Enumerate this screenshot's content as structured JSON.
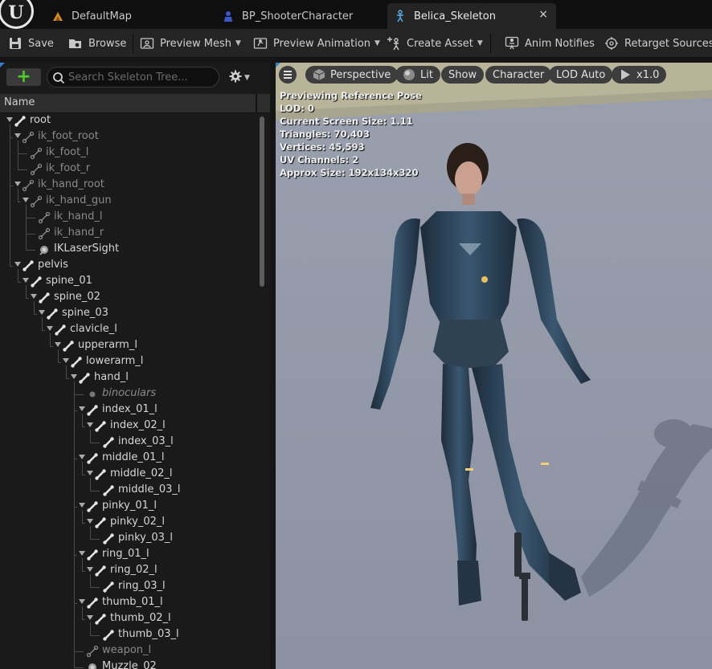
{
  "tabs": [
    {
      "label": "DefaultMap"
    },
    {
      "label": "BP_ShooterCharacter"
    },
    {
      "label": "Belica_Skeleton",
      "close": "×"
    }
  ],
  "toolbar": {
    "save": "Save",
    "browse": "Browse",
    "preview_mesh": "Preview Mesh",
    "preview_animation": "Preview Animation",
    "create_asset": "Create Asset",
    "anim_notifies": "Anim Notifies",
    "retarget_sources": "Retarget Sources"
  },
  "skeleton_tree": {
    "add_label": "+",
    "search_placeholder": "Search Skeleton Tree...",
    "column_name": "Name",
    "bones": [
      {
        "label": "root",
        "depth": 0,
        "kind": "bone",
        "expanded": true
      },
      {
        "label": "ik_foot_root",
        "depth": 1,
        "kind": "ik",
        "expanded": true
      },
      {
        "label": "ik_foot_l",
        "depth": 2,
        "kind": "ik"
      },
      {
        "label": "ik_foot_r",
        "depth": 2,
        "kind": "ik"
      },
      {
        "label": "ik_hand_root",
        "depth": 1,
        "kind": "ik",
        "expanded": true
      },
      {
        "label": "ik_hand_gun",
        "depth": 2,
        "kind": "ik",
        "expanded": true
      },
      {
        "label": "ik_hand_l",
        "depth": 3,
        "kind": "ik"
      },
      {
        "label": "ik_hand_r",
        "depth": 3,
        "kind": "ik"
      },
      {
        "label": "IKLaserSight",
        "depth": 3,
        "kind": "mesh-socket"
      },
      {
        "label": "pelvis",
        "depth": 1,
        "kind": "bone",
        "expanded": true
      },
      {
        "label": "spine_01",
        "depth": 2,
        "kind": "bone",
        "expanded": true
      },
      {
        "label": "spine_02",
        "depth": 3,
        "kind": "bone",
        "expanded": true
      },
      {
        "label": "spine_03",
        "depth": 4,
        "kind": "bone",
        "expanded": true
      },
      {
        "label": "clavicle_l",
        "depth": 5,
        "kind": "bone",
        "expanded": true
      },
      {
        "label": "upperarm_l",
        "depth": 6,
        "kind": "bone",
        "expanded": true
      },
      {
        "label": "lowerarm_l",
        "depth": 7,
        "kind": "bone",
        "expanded": true
      },
      {
        "label": "hand_l",
        "depth": 8,
        "kind": "bone",
        "expanded": true
      },
      {
        "label": "binoculars",
        "depth": 9,
        "kind": "socket"
      },
      {
        "label": "index_01_l",
        "depth": 9,
        "kind": "bone",
        "expanded": true
      },
      {
        "label": "index_02_l",
        "depth": 10,
        "kind": "bone",
        "expanded": true
      },
      {
        "label": "index_03_l",
        "depth": 11,
        "kind": "bone"
      },
      {
        "label": "middle_01_l",
        "depth": 9,
        "kind": "bone",
        "expanded": true
      },
      {
        "label": "middle_02_l",
        "depth": 10,
        "kind": "bone",
        "expanded": true
      },
      {
        "label": "middle_03_l",
        "depth": 11,
        "kind": "bone"
      },
      {
        "label": "pinky_01_l",
        "depth": 9,
        "kind": "bone",
        "expanded": true
      },
      {
        "label": "pinky_02_l",
        "depth": 10,
        "kind": "bone",
        "expanded": true
      },
      {
        "label": "pinky_03_l",
        "depth": 11,
        "kind": "bone"
      },
      {
        "label": "ring_01_l",
        "depth": 9,
        "kind": "bone",
        "expanded": true
      },
      {
        "label": "ring_02_l",
        "depth": 10,
        "kind": "bone",
        "expanded": true
      },
      {
        "label": "ring_03_l",
        "depth": 11,
        "kind": "bone"
      },
      {
        "label": "thumb_01_l",
        "depth": 9,
        "kind": "bone",
        "expanded": true
      },
      {
        "label": "thumb_02_l",
        "depth": 10,
        "kind": "bone",
        "expanded": true
      },
      {
        "label": "thumb_03_l",
        "depth": 11,
        "kind": "bone"
      },
      {
        "label": "weapon_l",
        "depth": 9,
        "kind": "ik"
      },
      {
        "label": "Muzzle_02",
        "depth": 9,
        "kind": "mesh-socket"
      }
    ]
  },
  "viewport": {
    "perspective": "Perspective",
    "lit": "Lit",
    "show": "Show",
    "character": "Character",
    "lod": "LOD Auto",
    "play_rate": "x1.0",
    "stats": [
      "Previewing Reference Pose",
      "LOD: 0",
      "Current Screen Size: 1.11",
      "Triangles: 70,403",
      "Vertices: 45,593",
      "UV Channels: 2",
      "Approx Size: 192x134x320"
    ]
  },
  "colors": {
    "accent_blue": "#2f80d0",
    "add_green": "#4fcc2a",
    "panel_bg": "#1a1a1a",
    "toolbar_bg": "#242424"
  }
}
